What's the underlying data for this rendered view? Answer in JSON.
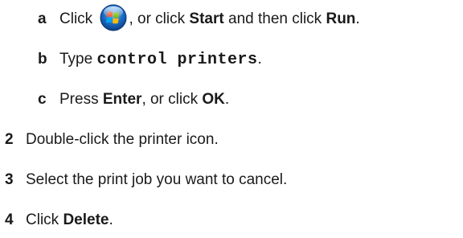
{
  "steps": {
    "a": {
      "marker": "a",
      "pre": "Click",
      "mid": ", or click",
      "start": "Start",
      "and": "and then click",
      "run": "Run",
      "end": ".",
      "icon": "windows-start-orb-icon"
    },
    "b": {
      "marker": "b",
      "pre": "Type",
      "code": "control printers",
      "end": "."
    },
    "c": {
      "marker": "c",
      "pre": "Press",
      "enter": "Enter",
      "mid": ", or click",
      "ok": "OK",
      "end": "."
    },
    "s2": {
      "marker": "2",
      "text": "Double-click the printer icon."
    },
    "s3": {
      "marker": "3",
      "text": "Select the print job you want to cancel."
    },
    "s4": {
      "marker": "4",
      "pre": "Click",
      "del": "Delete",
      "end": "."
    }
  },
  "colors": {
    "text": "#1a1a1a",
    "orb_blue": "#1e6fc8",
    "flag_red": "#f25022",
    "flag_green": "#7fba00",
    "flag_blue": "#00a4ef",
    "flag_yellow": "#ffb900"
  }
}
